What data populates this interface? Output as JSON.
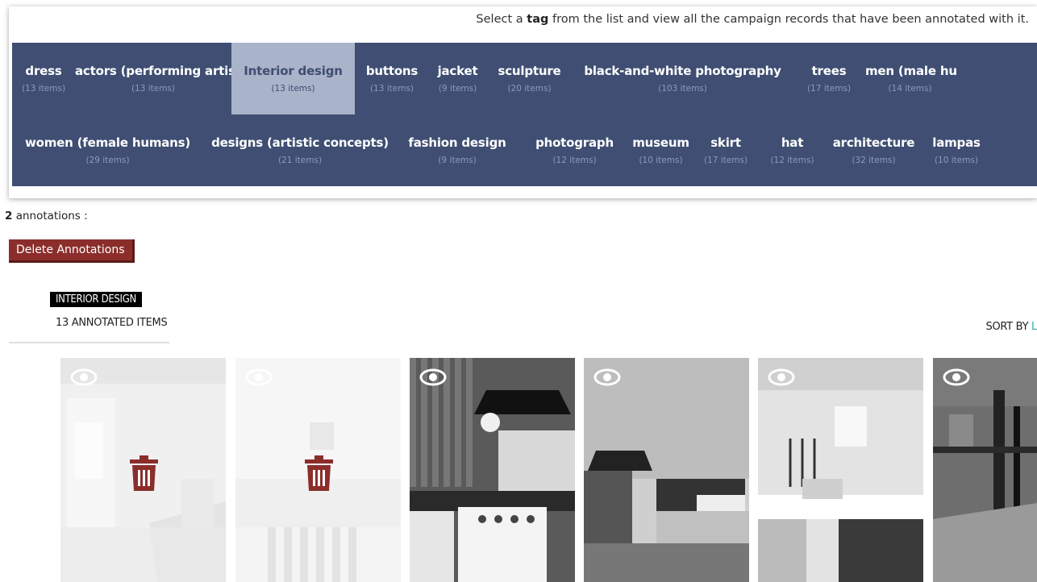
{
  "intro": {
    "pre": "Select a ",
    "bold": "tag",
    "post": " from the list and view all the campaign records that have been annotated with it."
  },
  "tags_row1": [
    {
      "name": "dress",
      "count": "(13 items)"
    },
    {
      "name": "actors (performing artists)",
      "count": "(13 items)"
    },
    {
      "name": "Interior design",
      "count": "(13 items)",
      "active": true
    },
    {
      "name": "buttons",
      "count": "(13 items)"
    },
    {
      "name": "jacket",
      "count": "(9 items)"
    },
    {
      "name": "sculpture",
      "count": "(20 items)"
    },
    {
      "name": "black-and-white photography",
      "count": "(103 items)"
    },
    {
      "name": "trees",
      "count": "(17 items)"
    },
    {
      "name": "men (male hu",
      "count": "(14 items)"
    }
  ],
  "tags_row2": [
    {
      "name": "women (female humans)",
      "count": "(29 items)"
    },
    {
      "name": "designs (artistic concepts)",
      "count": "(21 items)"
    },
    {
      "name": "fashion design",
      "count": "(9 items)"
    },
    {
      "name": "photograph",
      "count": "(12 items)"
    },
    {
      "name": "museum",
      "count": "(10 items)"
    },
    {
      "name": "skirt",
      "count": "(17 items)"
    },
    {
      "name": "hat",
      "count": "(12 items)"
    },
    {
      "name": "architecture",
      "count": "(32 items)"
    },
    {
      "name": "lampas",
      "count": "(10 items)"
    }
  ],
  "annotations": {
    "count": "2",
    "label": " annotations :"
  },
  "delete_button": "Delete Annotations",
  "category": {
    "title": "INTERIOR DESIGN",
    "subtitle": "13 ANNOTATED ITEMS"
  },
  "sort": {
    "label": "SORT BY ",
    "value": "L"
  },
  "cards": [
    {
      "icon": "eye-icon",
      "selected": true
    },
    {
      "icon": "eye-icon",
      "selected": true
    },
    {
      "icon": "eye-icon",
      "selected": false
    },
    {
      "icon": "eye-icon",
      "selected": false
    },
    {
      "icon": "eye-icon",
      "selected": false
    },
    {
      "icon": "eye-icon",
      "selected": false
    }
  ],
  "colors": {
    "tagbar": "#3f4e72",
    "active_tag": "#a9b3c9",
    "delete": "#8b2e2b",
    "trash": "#8b2e2b",
    "sort_accent": "#2ab0a0"
  }
}
